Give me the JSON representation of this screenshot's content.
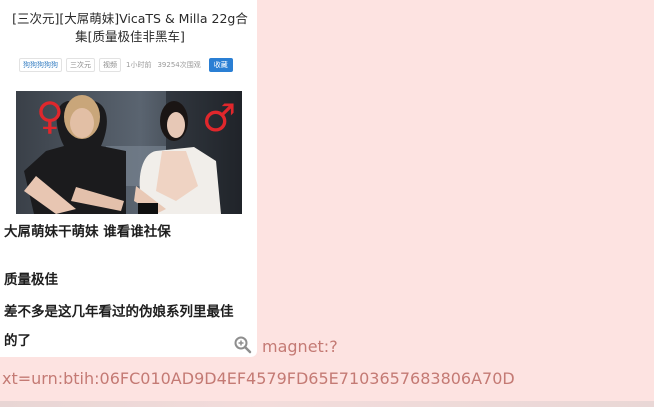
{
  "post": {
    "title_line1": "[三次元][大屌萌妹]VicaTS & Milla 22g合",
    "title_line2": "集[质量极佳非黑车]",
    "meta": {
      "author": "狗狗狗狗狗",
      "category": "三次元",
      "type": "视频",
      "time": "1小时前",
      "views": "39254次围观",
      "fav_label": "收藏"
    },
    "photo": {
      "left_symbol": "♀",
      "right_symbol": "♂"
    },
    "lines": {
      "line1": "大屌萌妹干萌妹 谁看谁社保",
      "line2": "质量极佳",
      "line3": "差不多是这几年看过的伪娘系列里最佳",
      "line4": "的了"
    }
  },
  "magnet": {
    "part1": "magnet:?",
    "part2": "xt=urn:btih:06FC010AD9D4EF4579FD65E7103657683806A70D"
  },
  "colors": {
    "background": "#fde3e1",
    "link": "#c47a74",
    "button": "#2a7fd4"
  },
  "icons": {
    "zoom": "magnifier-plus-icon"
  }
}
